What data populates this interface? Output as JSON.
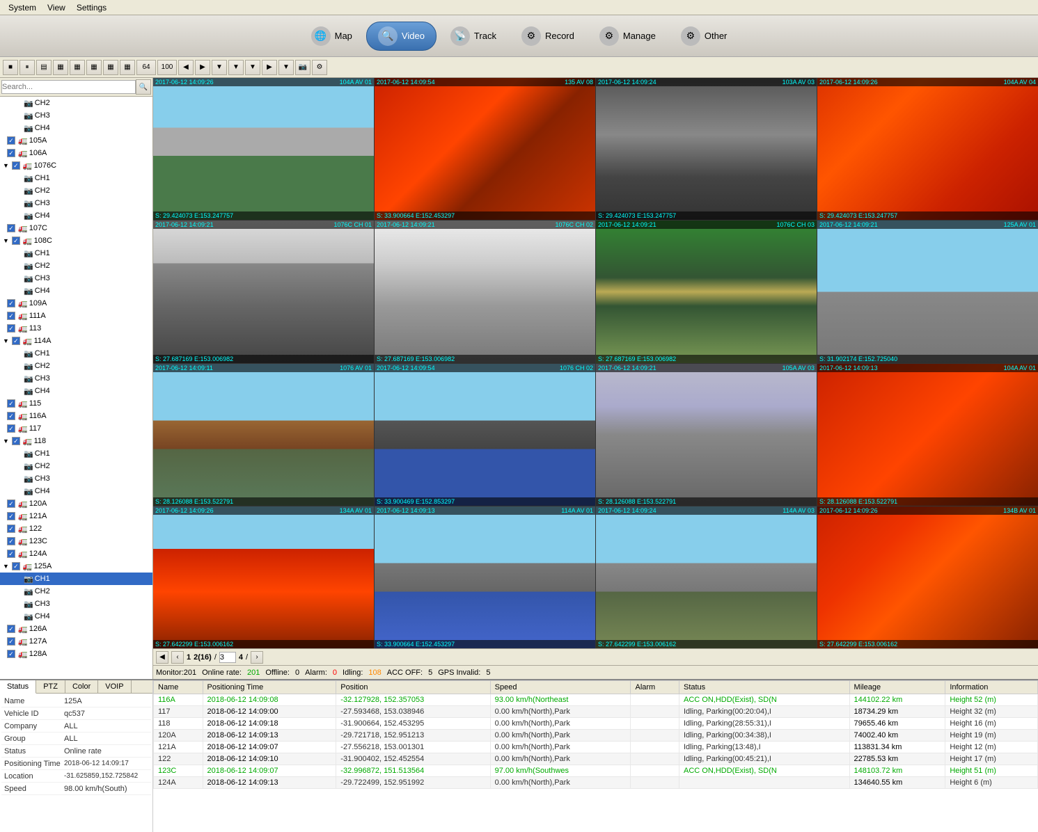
{
  "menubar": {
    "items": [
      "System",
      "View",
      "Settings"
    ]
  },
  "topnav": {
    "buttons": [
      {
        "id": "map",
        "label": "Map",
        "icon": "🌐",
        "active": false
      },
      {
        "id": "video",
        "label": "Video",
        "icon": "🔍",
        "active": true
      },
      {
        "id": "track",
        "label": "Track",
        "icon": "📡",
        "active": false
      },
      {
        "id": "record",
        "label": "Record",
        "icon": "⚙",
        "active": false
      },
      {
        "id": "manage",
        "label": "Manage",
        "icon": "⚙",
        "active": false
      },
      {
        "id": "other",
        "label": "Other",
        "icon": "⚙",
        "active": false
      }
    ]
  },
  "sidebar": {
    "search_placeholder": "Search...",
    "tree": [
      {
        "id": "ch2",
        "label": "CH2",
        "level": 2,
        "type": "channel"
      },
      {
        "id": "ch3",
        "label": "CH3",
        "level": 2,
        "type": "channel"
      },
      {
        "id": "ch4",
        "label": "CH4",
        "level": 2,
        "type": "channel"
      },
      {
        "id": "105a",
        "label": "105A",
        "level": 1,
        "type": "vehicle",
        "checked": true
      },
      {
        "id": "106a",
        "label": "106A",
        "level": 1,
        "type": "vehicle",
        "checked": true
      },
      {
        "id": "1076c",
        "label": "1076C",
        "level": 1,
        "type": "vehicle",
        "checked": true
      },
      {
        "id": "1076c_ch1",
        "label": "CH1",
        "level": 2,
        "type": "channel"
      },
      {
        "id": "1076c_ch2",
        "label": "CH2",
        "level": 2,
        "type": "channel"
      },
      {
        "id": "1076c_ch3",
        "label": "CH3",
        "level": 2,
        "type": "channel"
      },
      {
        "id": "1076c_ch4",
        "label": "CH4",
        "level": 2,
        "type": "channel"
      },
      {
        "id": "107c",
        "label": "107C",
        "level": 1,
        "type": "vehicle",
        "checked": true
      },
      {
        "id": "108c",
        "label": "108C",
        "level": 1,
        "type": "vehicle",
        "checked": true
      },
      {
        "id": "108c_ch1",
        "label": "CH1",
        "level": 2,
        "type": "channel"
      },
      {
        "id": "108c_ch2",
        "label": "CH2",
        "level": 2,
        "type": "channel"
      },
      {
        "id": "108c_ch3",
        "label": "CH3",
        "level": 2,
        "type": "channel"
      },
      {
        "id": "108c_ch4",
        "label": "CH4",
        "level": 2,
        "type": "channel"
      },
      {
        "id": "109a",
        "label": "109A",
        "level": 1,
        "type": "vehicle",
        "checked": true
      },
      {
        "id": "111a",
        "label": "111A",
        "level": 1,
        "type": "vehicle",
        "checked": true
      },
      {
        "id": "113",
        "label": "113",
        "level": 1,
        "type": "vehicle",
        "checked": true
      },
      {
        "id": "114a",
        "label": "114A",
        "level": 1,
        "type": "vehicle",
        "checked": true
      },
      {
        "id": "114a_ch1",
        "label": "CH1",
        "level": 2,
        "type": "channel"
      },
      {
        "id": "114a_ch2",
        "label": "CH2",
        "level": 2,
        "type": "channel"
      },
      {
        "id": "114a_ch3",
        "label": "CH3",
        "level": 2,
        "type": "channel"
      },
      {
        "id": "114a_ch4",
        "label": "CH4",
        "level": 2,
        "type": "channel"
      },
      {
        "id": "115",
        "label": "115",
        "level": 1,
        "type": "vehicle",
        "checked": true
      },
      {
        "id": "116a",
        "label": "116A",
        "level": 1,
        "type": "vehicle",
        "checked": true
      },
      {
        "id": "117",
        "label": "117",
        "level": 1,
        "type": "vehicle",
        "checked": true
      },
      {
        "id": "118",
        "label": "118",
        "level": 1,
        "type": "vehicle",
        "checked": true
      },
      {
        "id": "118_ch1",
        "label": "CH1",
        "level": 2,
        "type": "channel"
      },
      {
        "id": "118_ch2",
        "label": "CH2",
        "level": 2,
        "type": "channel"
      },
      {
        "id": "118_ch3",
        "label": "CH3",
        "level": 2,
        "type": "channel"
      },
      {
        "id": "118_ch4",
        "label": "CH4",
        "level": 2,
        "type": "channel"
      },
      {
        "id": "120a",
        "label": "120A",
        "level": 1,
        "type": "vehicle",
        "checked": true
      },
      {
        "id": "121a",
        "label": "121A",
        "level": 1,
        "type": "vehicle",
        "checked": true
      },
      {
        "id": "122",
        "label": "122",
        "level": 1,
        "type": "vehicle",
        "checked": true
      },
      {
        "id": "123c",
        "label": "123C",
        "level": 1,
        "type": "vehicle",
        "checked": true
      },
      {
        "id": "124a",
        "label": "124A",
        "level": 1,
        "type": "vehicle",
        "checked": true
      },
      {
        "id": "125a",
        "label": "125A",
        "level": 1,
        "type": "vehicle",
        "checked": true
      },
      {
        "id": "125a_ch1",
        "label": "CH1",
        "level": 2,
        "type": "channel",
        "selected": true
      },
      {
        "id": "125a_ch2",
        "label": "CH2",
        "level": 2,
        "type": "channel"
      },
      {
        "id": "125a_ch3",
        "label": "CH3",
        "level": 2,
        "type": "channel"
      },
      {
        "id": "125a_ch4",
        "label": "CH4",
        "level": 2,
        "type": "channel"
      },
      {
        "id": "126a",
        "label": "126A",
        "level": 1,
        "type": "vehicle",
        "checked": true
      },
      {
        "id": "127a",
        "label": "127A",
        "level": 1,
        "type": "vehicle",
        "checked": true
      },
      {
        "id": "128a",
        "label": "128A",
        "level": 1,
        "type": "vehicle",
        "checked": true
      }
    ]
  },
  "toolbar": {
    "buttons": [
      "■",
      "⏸",
      "▦",
      "▦",
      "▦",
      "▦",
      "▦",
      "▦",
      "64",
      "100",
      "◀",
      "▶",
      "▼",
      "▼",
      "▼",
      "▼",
      "◀",
      "▶",
      "▼",
      "▼",
      "▼"
    ]
  },
  "video_cells": [
    {
      "id": 1,
      "top_label": "2017-06-12 14:09:26",
      "top_right": "104A AV 01",
      "bottom": "S: 29.424073 E:153.247757",
      "cam_style": "cam-road"
    },
    {
      "id": 2,
      "top_label": "2017-06-12 14:09:54",
      "top_right": "135 AV 08",
      "bottom": "S: 33.900664 E:152.453297",
      "cam_style": "cam-truck-side"
    },
    {
      "id": 3,
      "top_label": "2017-06-12 14:09:24",
      "top_right": "103A AV 03",
      "bottom": "S: 29.424073 E:153.247757",
      "cam_style": "cam-close"
    },
    {
      "id": 4,
      "top_label": "2017-06-12 14:09:26",
      "top_right": "104A AV 04",
      "bottom": "S: 29.424073 E:153.247757",
      "cam_style": "cam-red-truck"
    },
    {
      "id": 5,
      "top_label": "2017-06-12 14:09:21",
      "top_right": "1076C CH 01",
      "bottom": "S: 27.687169 E:153.006982",
      "cam_style": "cam-parking"
    },
    {
      "id": 6,
      "top_label": "2017-06-12 14:09:21",
      "top_right": "1076C CH 02",
      "bottom": "S: 27.687169 E:153.006982",
      "cam_style": "cam-truck-side"
    },
    {
      "id": 7,
      "top_label": "2017-06-12 14:09:21",
      "top_right": "1076C CH 03",
      "bottom": "S: 27.687169 E:153.006982",
      "cam_style": "cam-outdoor"
    },
    {
      "id": 8,
      "top_label": "2017-06-12 14:09:21",
      "top_right": "125A AV 01",
      "bottom": "S: 31.902174 E:152.725040",
      "cam_style": "cam-highway"
    },
    {
      "id": 9,
      "top_label": "2017-06-12 14:09:11",
      "top_right": "1076 AV 01",
      "bottom": "S: 28.126088 E:153.522791",
      "cam_style": "cam-outdoor"
    },
    {
      "id": 10,
      "top_label": "2017-06-12 14:09:54",
      "top_right": "1076 CH 02",
      "bottom": "S: 33.900469 E:152.853297",
      "cam_style": "cam-parking"
    },
    {
      "id": 11,
      "top_label": "2017-06-12 14:09:21",
      "top_right": "105A AV 03",
      "bottom": "S: 28.126088 E:153.522791",
      "cam_style": "cam-barrier"
    },
    {
      "id": 12,
      "top_label": "2017-06-12 14:09:13",
      "top_right": "104A AV 01",
      "bottom": "S: 28.126088 E:153.522791",
      "cam_style": "cam-red-truck"
    },
    {
      "id": 13,
      "top_label": "2017-06-12 14:09:26",
      "top_right": "134A AV 01",
      "bottom": "S: 27.642299 E:153.006162",
      "cam_style": "cam-outdoor"
    },
    {
      "id": 14,
      "top_label": "2017-06-12 14:09:13",
      "top_right": "114A AV 01",
      "bottom": "S: 33.900664 E:152.453297",
      "cam_style": "cam-parking"
    },
    {
      "id": 15,
      "top_label": "2017-06-12 14:09:24",
      "top_right": "114A AV 03",
      "bottom": "S: 27.642299 E:153.006162",
      "cam_style": "cam-outdoor"
    },
    {
      "id": 16,
      "top_label": "2017-06-12 14:09:26",
      "top_right": "134B AV 01",
      "bottom": "S: 27.642299 E:153.006162",
      "cam_style": "cam-red-truck"
    }
  ],
  "pagination": {
    "prev_prev": "◀",
    "prev": "‹",
    "pages": [
      "1",
      "2(16)",
      "3",
      "4"
    ],
    "current_page": "2(16)",
    "next": "›",
    "slash": "/",
    "input_page": "3"
  },
  "statusbar": {
    "monitor": "Monitor:201",
    "online": "Online rate:",
    "online_val": "201",
    "offline": "Offline:",
    "offline_val": "0",
    "alarm": "Alarm:",
    "alarm_val": "0",
    "idling": "Idling:",
    "idling_val": "108",
    "acc_off": "ACC OFF:",
    "acc_off_val": "5",
    "gps_invalid": "GPS Invalid:",
    "gps_invalid_val": "5"
  },
  "info_panel": {
    "tabs": [
      "Status",
      "PTZ",
      "Color",
      "VOIP"
    ],
    "active_tab": "Status",
    "rows": [
      {
        "label": "Name",
        "value": "125A"
      },
      {
        "label": "Vehicle ID",
        "value": "qc537"
      },
      {
        "label": "Company",
        "value": "ALL"
      },
      {
        "label": "Group",
        "value": "ALL"
      },
      {
        "label": "Status",
        "value": "Online rate"
      },
      {
        "label": "Positioning Time",
        "value": "2018-06-12 14:09:17"
      },
      {
        "label": "Location",
        "value": "-31.625859,152.725842"
      },
      {
        "label": "Speed",
        "value": "98.00 km/h(South)"
      }
    ]
  },
  "table": {
    "columns": [
      "Name",
      "Positioning Time",
      "Position",
      "Speed",
      "Alarm",
      "Status",
      "Mileage",
      "Information"
    ],
    "rows": [
      {
        "name": "116A",
        "time": "2018-06-12 14:09:08",
        "position": "-32.127928, 152.357053",
        "speed": "93.00 km/h(Northeast",
        "alarm": "",
        "status": "ACC ON,HDD(Exist), SD(N",
        "mileage": "144102.22 km",
        "info": "Height 52 (m)",
        "highlight": true
      },
      {
        "name": "117",
        "time": "2018-06-12 14:09:00",
        "position": "-27.593468, 153.038946",
        "speed": "0.00 km/h(North),Park",
        "alarm": "",
        "status": "Idling, Parking(00:20:04),I",
        "mileage": "18734.29 km",
        "info": "Height 32 (m)",
        "highlight": false
      },
      {
        "name": "118",
        "time": "2018-06-12 14:09:18",
        "position": "-31.900664, 152.453295",
        "speed": "0.00 km/h(North),Park",
        "alarm": "",
        "status": "Idling, Parking(28:55:31),I",
        "mileage": "79655.46 km",
        "info": "Height 16 (m)",
        "highlight": false
      },
      {
        "name": "120A",
        "time": "2018-06-12 14:09:13",
        "position": "-29.721718, 152.951213",
        "speed": "0.00 km/h(North),Park",
        "alarm": "",
        "status": "Idling, Parking(00:34:38),I",
        "mileage": "74002.40 km",
        "info": "Height 19 (m)",
        "highlight": false
      },
      {
        "name": "121A",
        "time": "2018-06-12 14:09:07",
        "position": "-27.556218, 153.001301",
        "speed": "0.00 km/h(North),Park",
        "alarm": "",
        "status": "Idling, Parking(13:48),I",
        "mileage": "113831.34 km",
        "info": "Height 12 (m)",
        "highlight": false
      },
      {
        "name": "122",
        "time": "2018-06-12 14:09:10",
        "position": "-31.900402, 152.452554",
        "speed": "0.00 km/h(North),Park",
        "alarm": "",
        "status": "Idling, Parking(00:45:21),I",
        "mileage": "22785.53 km",
        "info": "Height 17 (m)",
        "highlight": false
      },
      {
        "name": "123C",
        "time": "2018-06-12 14:09:07",
        "position": "-32.996872, 151.513564",
        "speed": "97.00 km/h(Southwes",
        "alarm": "",
        "status": "ACC ON,HDD(Exist), SD(N",
        "mileage": "148103.72 km",
        "info": "Height 51 (m)",
        "highlight": true
      },
      {
        "name": "124A",
        "time": "2018-06-12 14:09:13",
        "position": "-29.722499, 152.951992",
        "speed": "0.00 km/h(North),Park",
        "alarm": "",
        "status": "",
        "mileage": "134640.55 km",
        "info": "Height 6 (m)",
        "highlight": false
      }
    ]
  }
}
